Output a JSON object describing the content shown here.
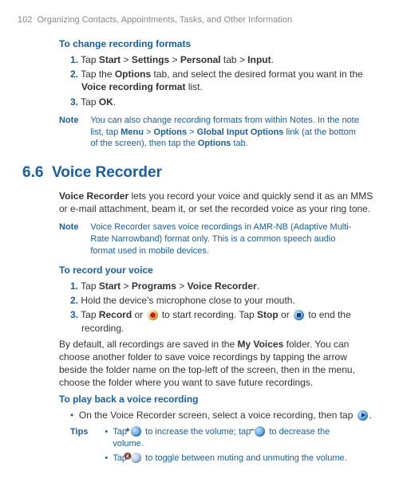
{
  "header": {
    "page": "102",
    "title": "Organizing Contacts, Appointments, Tasks, and Other Information"
  },
  "s1": {
    "title": "To change recording formats",
    "steps": [
      {
        "n": "1.",
        "pre": "Tap ",
        "b1": "Start",
        "s1": " > ",
        "b2": "Settings",
        "s2": " > ",
        "b3": "Personal",
        "s3": " tab > ",
        "b4": "Input",
        "end": "."
      },
      {
        "n": "2.",
        "pre": "Tap the ",
        "b1": "Options",
        "mid": " tab, and select the desired format you want in the ",
        "b2": "Voice recording format",
        "end": " list."
      },
      {
        "n": "3.",
        "pre": "Tap ",
        "b1": "OK",
        "end": "."
      }
    ],
    "note": {
      "label": "Note",
      "t1": "You can also change recording formats from within Notes. In the note list, tap ",
      "b1": "Menu",
      "s1": " > ",
      "b2": "Options",
      "s2": " > ",
      "b3": "Global Input Options",
      "t2": " link (at the bottom of the screen), then tap the ",
      "b4": "Options",
      "t3": " tab."
    }
  },
  "h": {
    "num": "6.6",
    "title": "Voice Recorder"
  },
  "intro": {
    "b": "Voice Recorder",
    "t": " lets you record your voice and quickly send it as an MMS or e-mail attachment, beam it, or set the recorded voice as your ring tone."
  },
  "n2": {
    "label": "Note",
    "t": "Voice Recorder saves voice recordings in AMR-NB (Adaptive Multi-Rate Narrowband) format only. This is a common speech audio format used in mobile devices."
  },
  "s2": {
    "title": "To record your voice",
    "st1": {
      "n": "1.",
      "pre": "Tap ",
      "b1": "Start",
      "s1": " > ",
      "b2": "Programs",
      "s2": " > ",
      "b3": "Voice Recorder",
      "end": "."
    },
    "st2": {
      "n": "2.",
      "t": "Hold the device's microphone close to your mouth."
    },
    "st3": {
      "n": "3.",
      "pre": "Tap ",
      "b1": "Record",
      "mid1": " or ",
      "mid2": " to start recording. Tap ",
      "b2": "Stop",
      "mid3": " or",
      "end": " to end the recording."
    }
  },
  "para": {
    "t1": "By default, all recordings are saved in the ",
    "b": "My Voices",
    "t2": " folder. You can choose another folder to save voice recordings by tapping the arrow beside the folder name on the top-left of the screen, then in the menu, choose the folder where you want to save future recordings."
  },
  "s3": {
    "title": "To play back a voice recording",
    "b1": {
      "t1": "On the Voice Recorder screen, select a voice recording, then tap",
      "end": "."
    },
    "tips": {
      "label": "Tips",
      "r1a": "Tap ",
      "r1b": " to increase the volume; tap",
      "r1c": " to decrease the volume.",
      "r2a": "Tap ",
      "r2b": " to toggle between muting and unmuting the volume."
    }
  }
}
